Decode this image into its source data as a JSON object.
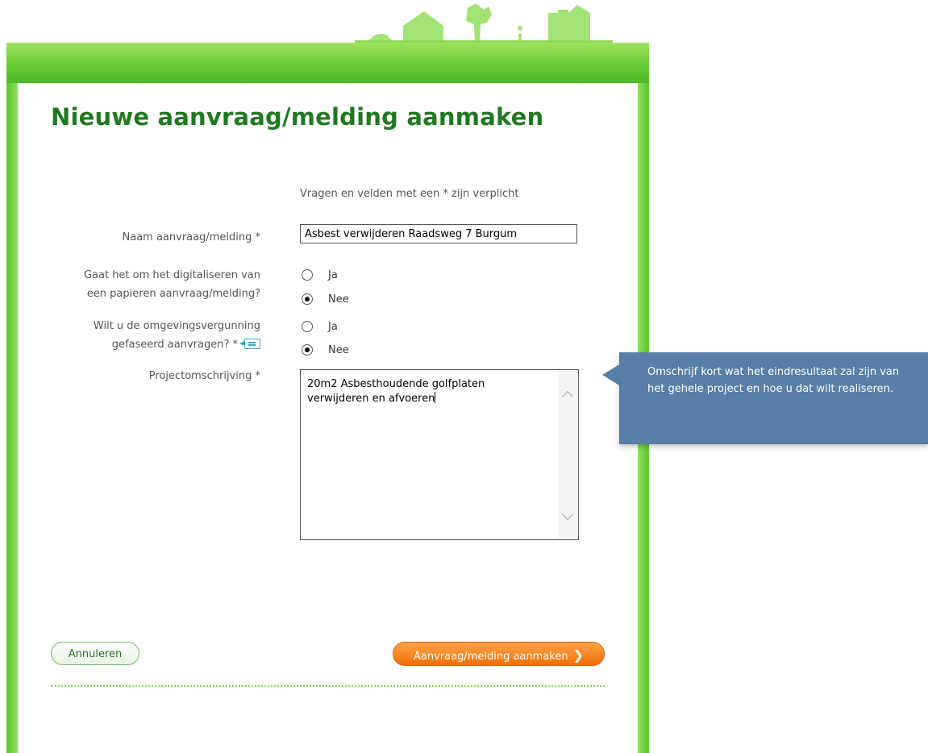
{
  "page": {
    "title": "Nieuwe aanvraag/melding aanmaken",
    "required_note": "Vragen en velden met een * zijn verplicht"
  },
  "form": {
    "naam": {
      "label": "Naam aanvraag/melding *",
      "value": "Asbest verwijderen Raadsweg 7 Burgum"
    },
    "digitaliseren": {
      "label_line1": "Gaat het om het digitaliseren van",
      "label_line2": "een papieren aanvraag/melding?",
      "options": [
        "Ja",
        "Nee"
      ],
      "selected": "Nee"
    },
    "gefaseerd": {
      "label_line1": "Wilt u de omgevingsvergunning",
      "label_line2": "gefaseerd aanvragen? *",
      "options": [
        "Ja",
        "Nee"
      ],
      "selected": "Nee",
      "info_icon": "info-bubble-icon"
    },
    "projectomschrijving": {
      "label": "Projectomschrijving *",
      "value": "20m2 Asbesthoudende golfplaten\nverwijderen en afvoeren"
    }
  },
  "tooltip": {
    "text": "Omschrijf kort wat het eindresultaat zal zijn van het gehele project en hoe u dat wilt realiseren."
  },
  "buttons": {
    "cancel": "Annuleren",
    "create": "Aanvraag/melding aanmaken",
    "create_icon": "chevron-right-icon"
  },
  "colors": {
    "frame_green": "#66cc33",
    "title_green": "#1f7a1f",
    "tooltip_blue": "#587fa7",
    "action_orange": "#f58220"
  }
}
